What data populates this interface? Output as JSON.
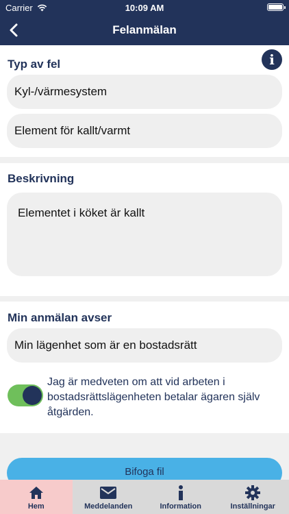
{
  "status_bar": {
    "carrier": "Carrier",
    "time": "10:09 AM"
  },
  "nav": {
    "title": "Felanmälan"
  },
  "fault_type": {
    "title": "Typ av fel",
    "field1": "Kyl-/värmesystem",
    "field2": "Element för kallt/varmt"
  },
  "description": {
    "title": "Beskrivning",
    "text": "Elementet i köket är kallt"
  },
  "concerns": {
    "title": "Min anmälan avser",
    "value": "Min lägenhet som är en bostadsrätt"
  },
  "consent": {
    "text": "Jag är medveten om att vid arbeten i bostadsrättslägenheten betalar ägaren själv åtgärden.",
    "checked": true
  },
  "attach_label": "Bifoga fil",
  "tabs": [
    {
      "label": "Hem",
      "icon": "home-icon",
      "active": true
    },
    {
      "label": "Meddelanden",
      "icon": "mail-icon",
      "active": false
    },
    {
      "label": "Information",
      "icon": "info-icon",
      "active": false
    },
    {
      "label": "Inställningar",
      "icon": "gear-icon",
      "active": false
    }
  ],
  "colors": {
    "primary": "#22335a",
    "accent": "#49b1e6",
    "toggle_on": "#6fbf5b",
    "active_tab": "#f7cbcb"
  }
}
